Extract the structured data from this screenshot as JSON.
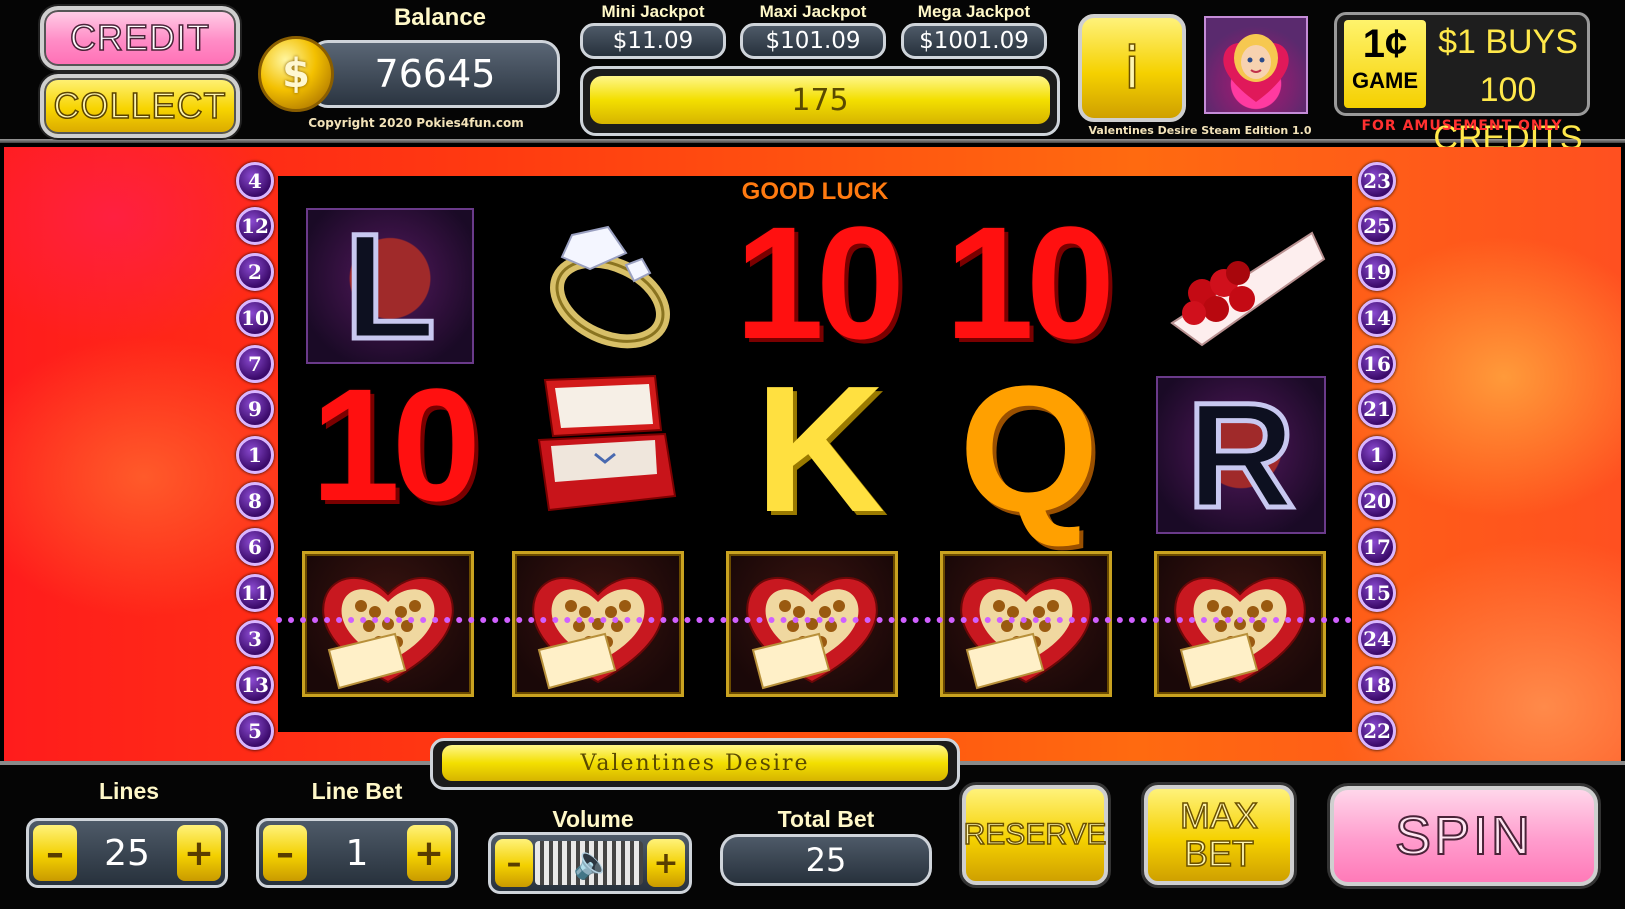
{
  "header": {
    "credit_label": "CREDIT",
    "collect_label": "COLLECT",
    "balance_label": "Balance",
    "balance_value": "76645",
    "coin_symbol": "$",
    "copyright": "Copyright 2020 Pokies4fun.com",
    "jackpots": [
      {
        "label": "Mini Jackpot",
        "value": "$11.09"
      },
      {
        "label": "Maxi Jackpot",
        "value": "$101.09"
      },
      {
        "label": "Mega Jackpot",
        "value": "$1001.09"
      }
    ],
    "win_value": "175",
    "info_label": "i",
    "edition": "Valentines Desire Steam Edition 1.0",
    "badge_cent": "1¢",
    "badge_game": "GAME",
    "badge_buys_line1": "$1 BUYS",
    "badge_buys_line2": "100 CREDITS",
    "amusement": "FOR AMUSEMENT ONLY"
  },
  "reels": {
    "status": "GOOD LUCK",
    "row1": {
      "c1": "L",
      "c3": "10",
      "c4": "10"
    },
    "row2": {
      "c1": "10",
      "c3": "K",
      "c4": "Q",
      "c5": "R"
    },
    "symbols_icons": [
      "letter-L-icon",
      "diamond-ring-icon",
      "ten-icon",
      "ten-icon",
      "rose-bouquet-icon",
      "ten-icon",
      "ring-box-icon",
      "king-icon",
      "queen-icon",
      "letter-R-icon",
      "chocolate-box-icon"
    ],
    "left_lines": [
      "4",
      "12",
      "2",
      "10",
      "7",
      "9",
      "1",
      "8",
      "6",
      "11",
      "3",
      "13",
      "5"
    ],
    "right_lines": [
      "23",
      "25",
      "19",
      "14",
      "16",
      "21",
      "1",
      "20",
      "17",
      "15",
      "24",
      "18",
      "22"
    ]
  },
  "footer": {
    "game_title": "Valentines Desire",
    "lines_label": "Lines",
    "lines_value": "25",
    "line_bet_label": "Line Bet",
    "line_bet_value": "1",
    "volume_label": "Volume",
    "total_bet_label": "Total Bet",
    "total_bet_value": "25",
    "minus": "–",
    "plus": "+",
    "reserve_label": "RESERVE",
    "max_label": "MAX",
    "bet_label": "BET",
    "spin_label": "SPIN"
  },
  "colors": {
    "accent_yellow": "#f3df00",
    "accent_pink": "#ff8cc6",
    "line_marker_purple": "#3b0a6a",
    "background_red": "#ff2a10"
  }
}
